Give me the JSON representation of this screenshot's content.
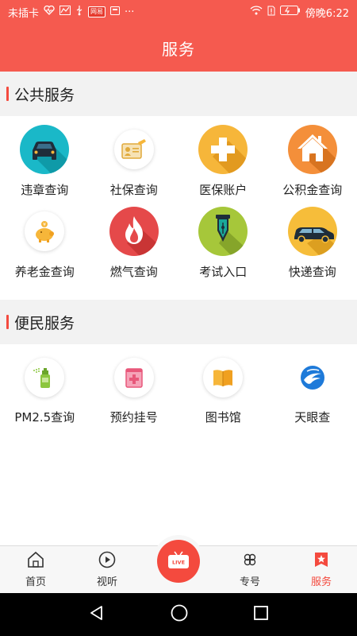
{
  "status": {
    "carrier": "未插卡",
    "time": "傍晚6:22",
    "dots": "···",
    "badge_text": "网易"
  },
  "header": {
    "title": "服务"
  },
  "public": {
    "title": "公共服务",
    "items": [
      {
        "label": "违章查询",
        "icon": "car-icon",
        "color": "#1ab8c8"
      },
      {
        "label": "社保查询",
        "icon": "id-card-icon",
        "color": "#ffffff"
      },
      {
        "label": "医保账户",
        "icon": "medical-cross-icon",
        "color": "#f6b63a"
      },
      {
        "label": "公积金查询",
        "icon": "house-icon",
        "color": "#f48f3a"
      },
      {
        "label": "养老金查询",
        "icon": "piggy-bank-icon",
        "color": "#ffffff"
      },
      {
        "label": "燃气查询",
        "icon": "flame-icon",
        "color": "#e5494a"
      },
      {
        "label": "考试入口",
        "icon": "pen-nib-icon",
        "color": "#a6c73a"
      },
      {
        "label": "快递查询",
        "icon": "delivery-car-icon",
        "color": "#f6bd3a"
      }
    ]
  },
  "convenience": {
    "title": "便民服务",
    "items": [
      {
        "label": "PM2.5查询",
        "icon": "spray-bottle-icon"
      },
      {
        "label": "预约挂号",
        "icon": "hospital-register-icon"
      },
      {
        "label": "图书馆",
        "icon": "book-icon"
      },
      {
        "label": "天眼查",
        "icon": "eye-logo-icon"
      }
    ]
  },
  "nav": {
    "home": "首页",
    "video": "视听",
    "live": "LIVE",
    "special": "专号",
    "service": "服务"
  },
  "colors": {
    "brand": "#f55a4f",
    "accent": "#f44a3e"
  }
}
